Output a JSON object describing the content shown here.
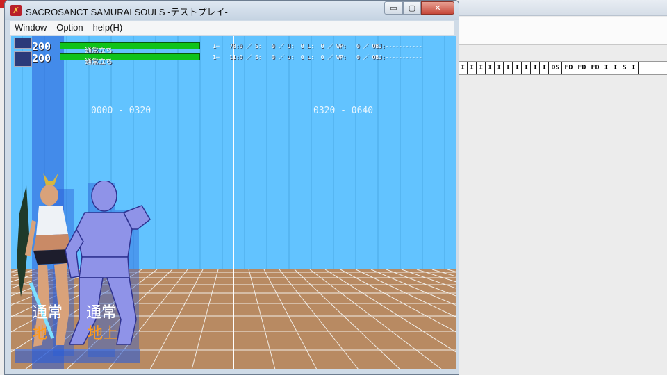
{
  "window": {
    "title": "SACROSANCT SAMURAI SOULS -テストプレイ-",
    "minimize_symbol": "▭",
    "maximize_symbol": "▢",
    "close_symbol": "✕"
  },
  "menu": {
    "items": [
      "Window",
      "Option",
      "help(H)"
    ]
  },
  "hud": {
    "p1": {
      "life": "200",
      "state": "通常立ち",
      "life_fraction": 1.0
    },
    "p2": {
      "life": "200",
      "state": "通常立ち",
      "life_fraction": 1.0
    },
    "debug": [
      "1─   78:0 ／ S:   0 ／ U:  0 L:  0 ／ WP:   0 ／ OBJ:-----------",
      "1─   11:0 ／ S:   0 ／ U:  0 L:  0 ／ WP:   0 ／ OBJ:-----------"
    ]
  },
  "stage": {
    "range_left": "0000 - 0320",
    "range_right": "0320 - 0640"
  },
  "status": {
    "p1_state_big": "通常",
    "p1_ground_big": "地",
    "p2_state_big": "通常",
    "p2_ground_big": "地上"
  },
  "background_app": {
    "frame_strip": [
      "I",
      "I",
      "I",
      "I",
      "I",
      "I",
      "I",
      "I",
      "I",
      "I",
      "DS",
      "FD",
      "FD",
      "FD",
      "I",
      "I",
      "S",
      "I"
    ]
  },
  "colors": {
    "sky": "#62c3ff",
    "floor": "#b88a62",
    "life_green": "#10c31a",
    "collision_blue": "#2a5dd8",
    "dummy_body": "#8f93e8",
    "orange_text": "#ff9a1a"
  }
}
